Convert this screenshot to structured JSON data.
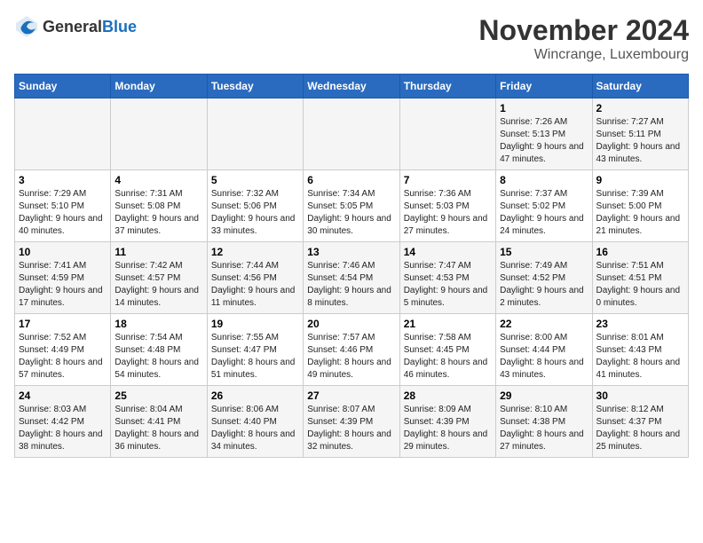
{
  "header": {
    "logo_general": "General",
    "logo_blue": "Blue",
    "month": "November 2024",
    "location": "Wincrange, Luxembourg"
  },
  "days_of_week": [
    "Sunday",
    "Monday",
    "Tuesday",
    "Wednesday",
    "Thursday",
    "Friday",
    "Saturday"
  ],
  "weeks": [
    [
      {
        "day": "",
        "info": ""
      },
      {
        "day": "",
        "info": ""
      },
      {
        "day": "",
        "info": ""
      },
      {
        "day": "",
        "info": ""
      },
      {
        "day": "",
        "info": ""
      },
      {
        "day": "1",
        "info": "Sunrise: 7:26 AM\nSunset: 5:13 PM\nDaylight: 9 hours and 47 minutes."
      },
      {
        "day": "2",
        "info": "Sunrise: 7:27 AM\nSunset: 5:11 PM\nDaylight: 9 hours and 43 minutes."
      }
    ],
    [
      {
        "day": "3",
        "info": "Sunrise: 7:29 AM\nSunset: 5:10 PM\nDaylight: 9 hours and 40 minutes."
      },
      {
        "day": "4",
        "info": "Sunrise: 7:31 AM\nSunset: 5:08 PM\nDaylight: 9 hours and 37 minutes."
      },
      {
        "day": "5",
        "info": "Sunrise: 7:32 AM\nSunset: 5:06 PM\nDaylight: 9 hours and 33 minutes."
      },
      {
        "day": "6",
        "info": "Sunrise: 7:34 AM\nSunset: 5:05 PM\nDaylight: 9 hours and 30 minutes."
      },
      {
        "day": "7",
        "info": "Sunrise: 7:36 AM\nSunset: 5:03 PM\nDaylight: 9 hours and 27 minutes."
      },
      {
        "day": "8",
        "info": "Sunrise: 7:37 AM\nSunset: 5:02 PM\nDaylight: 9 hours and 24 minutes."
      },
      {
        "day": "9",
        "info": "Sunrise: 7:39 AM\nSunset: 5:00 PM\nDaylight: 9 hours and 21 minutes."
      }
    ],
    [
      {
        "day": "10",
        "info": "Sunrise: 7:41 AM\nSunset: 4:59 PM\nDaylight: 9 hours and 17 minutes."
      },
      {
        "day": "11",
        "info": "Sunrise: 7:42 AM\nSunset: 4:57 PM\nDaylight: 9 hours and 14 minutes."
      },
      {
        "day": "12",
        "info": "Sunrise: 7:44 AM\nSunset: 4:56 PM\nDaylight: 9 hours and 11 minutes."
      },
      {
        "day": "13",
        "info": "Sunrise: 7:46 AM\nSunset: 4:54 PM\nDaylight: 9 hours and 8 minutes."
      },
      {
        "day": "14",
        "info": "Sunrise: 7:47 AM\nSunset: 4:53 PM\nDaylight: 9 hours and 5 minutes."
      },
      {
        "day": "15",
        "info": "Sunrise: 7:49 AM\nSunset: 4:52 PM\nDaylight: 9 hours and 2 minutes."
      },
      {
        "day": "16",
        "info": "Sunrise: 7:51 AM\nSunset: 4:51 PM\nDaylight: 9 hours and 0 minutes."
      }
    ],
    [
      {
        "day": "17",
        "info": "Sunrise: 7:52 AM\nSunset: 4:49 PM\nDaylight: 8 hours and 57 minutes."
      },
      {
        "day": "18",
        "info": "Sunrise: 7:54 AM\nSunset: 4:48 PM\nDaylight: 8 hours and 54 minutes."
      },
      {
        "day": "19",
        "info": "Sunrise: 7:55 AM\nSunset: 4:47 PM\nDaylight: 8 hours and 51 minutes."
      },
      {
        "day": "20",
        "info": "Sunrise: 7:57 AM\nSunset: 4:46 PM\nDaylight: 8 hours and 49 minutes."
      },
      {
        "day": "21",
        "info": "Sunrise: 7:58 AM\nSunset: 4:45 PM\nDaylight: 8 hours and 46 minutes."
      },
      {
        "day": "22",
        "info": "Sunrise: 8:00 AM\nSunset: 4:44 PM\nDaylight: 8 hours and 43 minutes."
      },
      {
        "day": "23",
        "info": "Sunrise: 8:01 AM\nSunset: 4:43 PM\nDaylight: 8 hours and 41 minutes."
      }
    ],
    [
      {
        "day": "24",
        "info": "Sunrise: 8:03 AM\nSunset: 4:42 PM\nDaylight: 8 hours and 38 minutes."
      },
      {
        "day": "25",
        "info": "Sunrise: 8:04 AM\nSunset: 4:41 PM\nDaylight: 8 hours and 36 minutes."
      },
      {
        "day": "26",
        "info": "Sunrise: 8:06 AM\nSunset: 4:40 PM\nDaylight: 8 hours and 34 minutes."
      },
      {
        "day": "27",
        "info": "Sunrise: 8:07 AM\nSunset: 4:39 PM\nDaylight: 8 hours and 32 minutes."
      },
      {
        "day": "28",
        "info": "Sunrise: 8:09 AM\nSunset: 4:39 PM\nDaylight: 8 hours and 29 minutes."
      },
      {
        "day": "29",
        "info": "Sunrise: 8:10 AM\nSunset: 4:38 PM\nDaylight: 8 hours and 27 minutes."
      },
      {
        "day": "30",
        "info": "Sunrise: 8:12 AM\nSunset: 4:37 PM\nDaylight: 8 hours and 25 minutes."
      }
    ]
  ]
}
